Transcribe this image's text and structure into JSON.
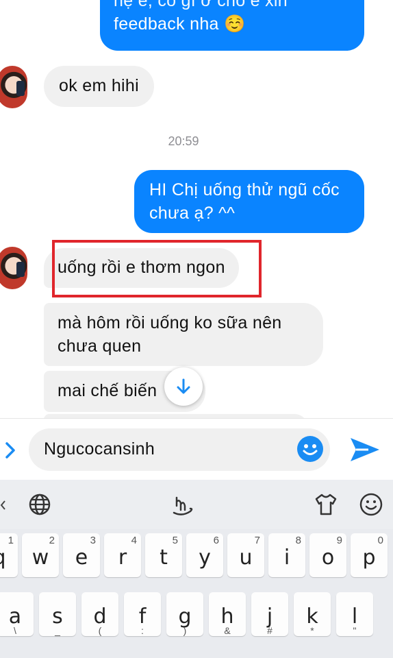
{
  "messages": {
    "top_outgoing_partial": "hệ e, có gì ở chỗ e xin",
    "top_outgoing_line2": "feedback nha ☺️",
    "incoming_1": "ok em hihi",
    "timestamp": "20:59",
    "outgoing_2_line1": "HI Chị uống thử ngũ cốc",
    "outgoing_2_line2": "chưa ạ? ^^",
    "incoming_2": "uống rồi e thơm ngon",
    "incoming_3_line1": "mà hôm rồi uống ko sữa nên",
    "incoming_3_line2": "chưa quen",
    "incoming_4": "mai chế biến"
  },
  "composer": {
    "input_value": "Ngucocansinh"
  },
  "keyboard": {
    "row1": [
      {
        "key": "q",
        "hint": "1"
      },
      {
        "key": "w",
        "hint": "2"
      },
      {
        "key": "e",
        "hint": "3"
      },
      {
        "key": "r",
        "hint": "4"
      },
      {
        "key": "t",
        "hint": "5"
      },
      {
        "key": "y",
        "hint": "6"
      },
      {
        "key": "u",
        "hint": "7"
      },
      {
        "key": "i",
        "hint": "8"
      },
      {
        "key": "o",
        "hint": "9"
      },
      {
        "key": "p",
        "hint": "0"
      }
    ],
    "row2": [
      {
        "key": "a",
        "hint": "\\"
      },
      {
        "key": "s",
        "hint": "_"
      },
      {
        "key": "d",
        "hint": "("
      },
      {
        "key": "f",
        "hint": ":"
      },
      {
        "key": "g",
        "hint": ")"
      },
      {
        "key": "h",
        "hint": "&"
      },
      {
        "key": "j",
        "hint": "#"
      },
      {
        "key": "k",
        "hint": "*"
      },
      {
        "key": "l",
        "hint": "\""
      }
    ]
  },
  "colors": {
    "accent": "#0a84ff",
    "highlight_box": "#e0262c",
    "incoming_bubble": "#f0f0f0"
  },
  "icons": [
    "expand-icon",
    "emoji-icon",
    "send-icon",
    "globe-icon",
    "handwriting-icon",
    "shirt-icon",
    "smiley-icon",
    "arrow-down-icon"
  ]
}
